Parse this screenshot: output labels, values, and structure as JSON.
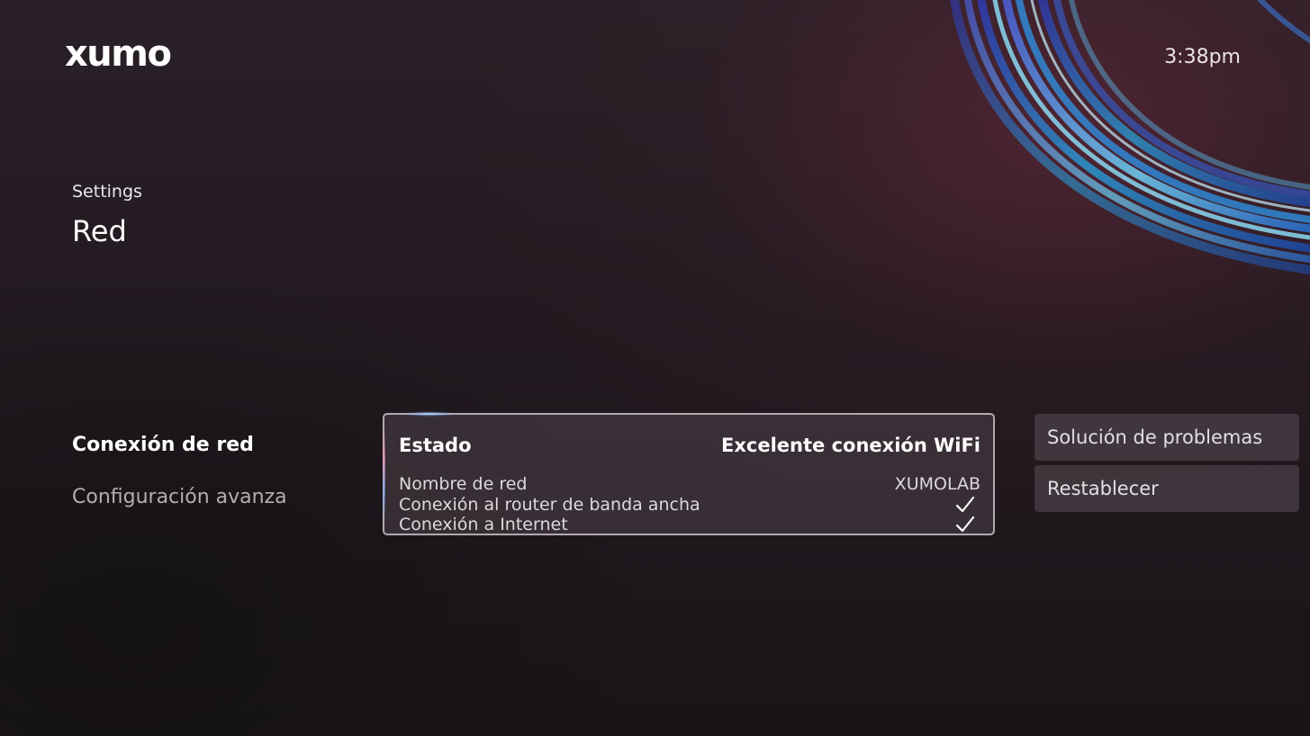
{
  "header": {
    "logo_text": "xumo",
    "time": "3:38pm"
  },
  "breadcrumb": "Settings",
  "page_title": "Red",
  "menu": {
    "items": [
      {
        "label": "Conexión de red",
        "active": true
      },
      {
        "label": "Configuración avanza",
        "active": false
      }
    ]
  },
  "status_card": {
    "heading_label": "Estado",
    "heading_value": "Excelente conexión WiFi",
    "rows": [
      {
        "label": "Nombre de red",
        "value": "XUMOLAB"
      },
      {
        "label": "Conexión al router de banda ancha",
        "value": "check-icon"
      },
      {
        "label": "Conexión a Internet",
        "value": "check-icon"
      }
    ]
  },
  "actions": [
    {
      "label": "Solución de problemas"
    },
    {
      "label": "Restablecer"
    }
  ],
  "colors": {
    "background": "#1c161b",
    "accent_blue": "#3aa0e8",
    "text_primary": "#ffffff",
    "text_secondary": "#b4aeb3"
  }
}
